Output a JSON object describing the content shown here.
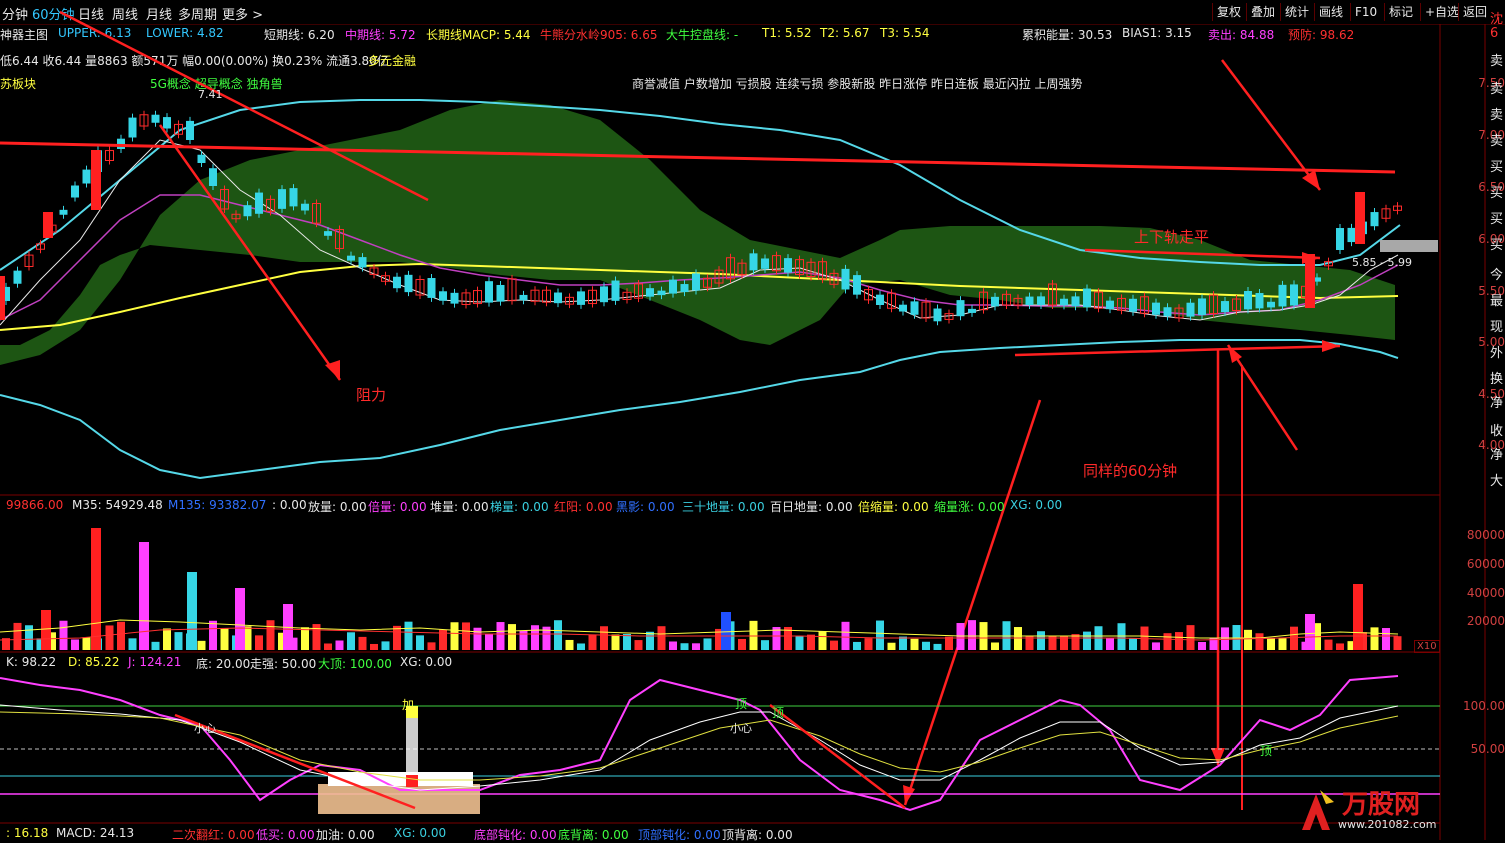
{
  "toolbar": {
    "periods": [
      "分钟",
      "60分钟",
      "日线",
      "周线",
      "月线",
      "多周期",
      "更多 >"
    ],
    "active_period": "60分钟",
    "right_buttons": [
      "复权",
      "叠加",
      "统计",
      "画线",
      "F10",
      "标记",
      "+自选",
      "返回"
    ]
  },
  "indicator_line": {
    "upper": "UPPER: 6.13",
    "lower": "LOWER: 4.82",
    "short": "短期线: 6.20",
    "mid": "中期线: 5.72",
    "long_macp": "长期线MACP: 5.44",
    "water": "牛熊分水岭905: 6.65",
    "bull": "大牛控盘线: -",
    "t1": "T1: 5.52",
    "t2": "T2: 5.67",
    "t3": "T3: 5.54",
    "energy": "累积能量: 30.53",
    "bias": "BIAS1: 3.15",
    "sell": "卖出: 84.88",
    "warn": "预防: 98.62"
  },
  "main_title": "神器主图",
  "quote_line": "低6.44 收6.44 量8863 额571万 幅0.00(0.00%) 换0.23% 流通3.80亿",
  "concept": "多元金融",
  "board_label": "苏板块",
  "concept_tags": "5G概念 超导概念 独角兽",
  "tags_line": "商誉减值 户数增加 亏损股 连续亏损 参股新股 昨日涨停 昨日连板 最近闪拉 上周强势",
  "price_high_label": "7.41",
  "price_range_label": "5.85 - 5.99",
  "price_axis": [
    "7.50",
    "7.00",
    "6.50",
    "6.00",
    "5.50",
    "5.00",
    "4.50",
    "4.00"
  ],
  "annotations": {
    "resistance": "阻力",
    "flat": "上下轨走平",
    "same60": "同样的60分钟"
  },
  "volume_line": {
    "m1": "99866.00",
    "m35": "M35: 54929.48",
    "m135": "M135: 93382.07",
    "v0": ": 0.00",
    "fang": "放量: 0.00",
    "bei": "倍量: 0.00",
    "dui": "堆量: 0.00",
    "ti": "梯量: 0.00",
    "hong": "红阳: 0.00",
    "an": "黑影: 0.00",
    "sanshi": "三十地量: 0.00",
    "bairi": "百日地量: 0.00",
    "beisuo": "倍缩量: 0.00",
    "suo": "缩量涨: 0.00",
    "xg": "XG: 0.00"
  },
  "volume_axis": [
    "80000",
    "60000",
    "40000",
    "20000"
  ],
  "volume_unit": "X10",
  "kdj_line": {
    "k": "K: 98.22",
    "d": "D: 85.22",
    "j": "J: 124.21",
    "di": "底: 20.00",
    "zq": "走强: 50.00",
    "dd": "大顶: 100.00",
    "xg": "XG: 0.00"
  },
  "kdj_axis": [
    "100.00",
    "50.00"
  ],
  "kdj_labels": {
    "top": "顶",
    "heart": "小心",
    "add": "加"
  },
  "bottom_line": {
    "v": ": 16.18",
    "macd": "MACD: 24.13",
    "erci": "二次翻红: 0.00",
    "dimai": "低买: 0.00",
    "jia": "加油: 0.00",
    "xg": "XG: 0.00",
    "dbdh": "底部钝化: 0.00",
    "dbl": "底背离: 0.00",
    "dbdh2": "顶部钝化: 0.00",
    "dbl2": "顶背离: 0.00"
  },
  "right_column": [
    "沈",
    "6",
    "卖",
    "卖",
    "卖",
    "卖",
    "买",
    "买",
    "买",
    "买",
    "今",
    "最",
    "现",
    "外",
    "换",
    "净",
    "收",
    "净",
    "大"
  ],
  "watermark": "万股网",
  "watermark_url": "www.201082.com",
  "colors": {
    "up": "#ff2b2b",
    "down": "#36d6e6",
    "cloud": "#1f5a14",
    "accent": "#33c8ff"
  }
}
